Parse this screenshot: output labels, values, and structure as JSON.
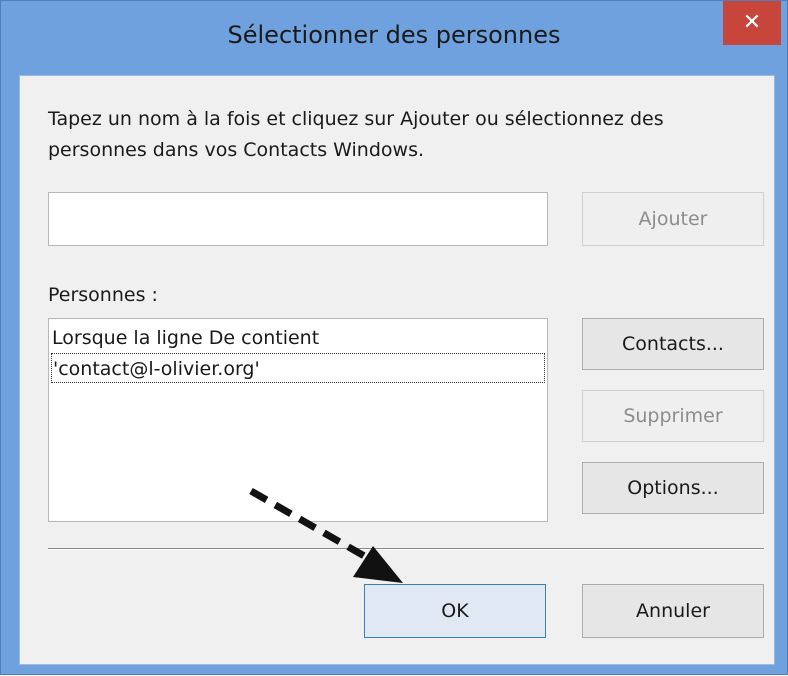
{
  "dialog": {
    "title": "Sélectionner des personnes",
    "close_label": "✕",
    "instructions": "Tapez un nom à la fois et cliquez sur Ajouter ou sélectionnez des personnes dans vos Contacts Windows.",
    "name_input": {
      "value": "",
      "placeholder": ""
    },
    "add_button": "Ajouter",
    "people_label": "Personnes :",
    "people": [
      "Lorsque la ligne De contient",
      "'contact@l-olivier.org'"
    ],
    "contacts_button": "Contacts...",
    "remove_button": "Supprimer",
    "options_button": "Options...",
    "ok_button": "OK",
    "cancel_button": "Annuler"
  },
  "colors": {
    "titlebar": "#6ea1dd",
    "close_button": "#c7453a",
    "client": "#f0f0f0"
  }
}
